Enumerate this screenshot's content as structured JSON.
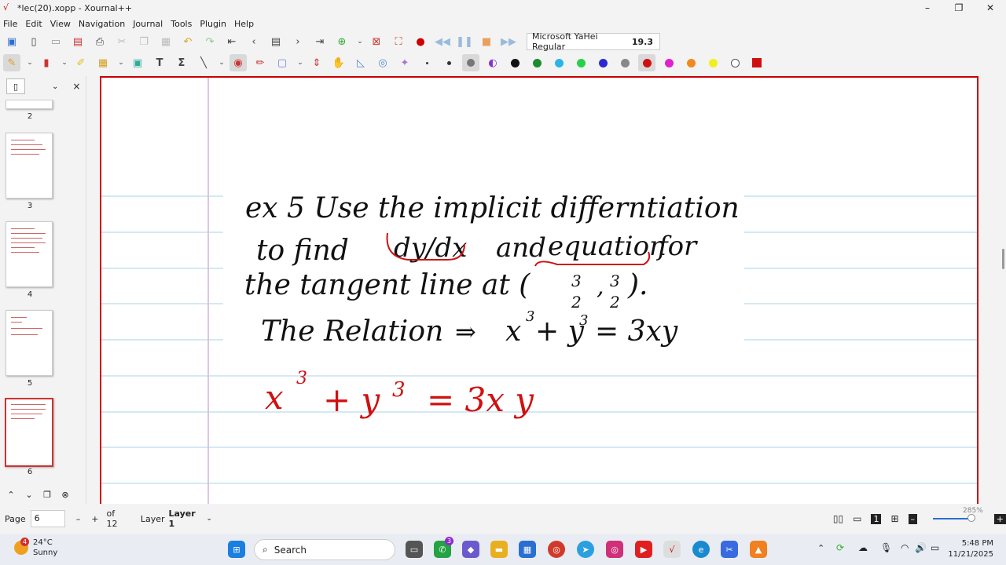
{
  "window": {
    "title": "*lec(20).xopp - Xournal++",
    "minimize": "–",
    "maximize": "❐",
    "close": "✕"
  },
  "menu": [
    "File",
    "Edit",
    "View",
    "Navigation",
    "Journal",
    "Tools",
    "Plugin",
    "Help"
  ],
  "font_selector": {
    "name": "Microsoft YaHei Regular",
    "size": "19.3"
  },
  "colors": [
    "#111111",
    "#1e8a2e",
    "#29b6e6",
    "#27d04a",
    "#2a2ad0",
    "#888888",
    "#d01010",
    "#e020d0",
    "#f08a20",
    "#f0f020",
    "#ffffff"
  ],
  "sidebar": {
    "close": "×",
    "page_numbers": [
      "2",
      "3",
      "4",
      "5",
      "6"
    ]
  },
  "status": {
    "page_label": "Page",
    "page_value": "6",
    "minus": "–",
    "plus": "+",
    "of_pages": "of 12",
    "layer_label": "Layer",
    "layer_value": "Layer 1",
    "zoom": "285%"
  },
  "notes": {
    "line1": "ex 5 Use the implicit differntiation",
    "line2a": "to find",
    "line2b": "dy/dx",
    "line2c": "and",
    "line2d": "equation",
    "line2e": "for",
    "line3": "the tangent line at (",
    "frac_num": "3",
    "frac_den": "2",
    "comma": ",",
    "close_paren": ").",
    "line4a": "The Relation",
    "line4b": "x",
    "line4c": "+ y",
    "line4d": "= 3xy",
    "exp": "3",
    "line5a": "x",
    "line5b": "+ y",
    "line5c": "= 3x y"
  },
  "taskbar": {
    "temp": "24°C",
    "weather": "Sunny",
    "search": "Search",
    "time": "5:48 PM",
    "date": "11/21/2025",
    "badge": "4",
    "wa_badge": "3"
  }
}
